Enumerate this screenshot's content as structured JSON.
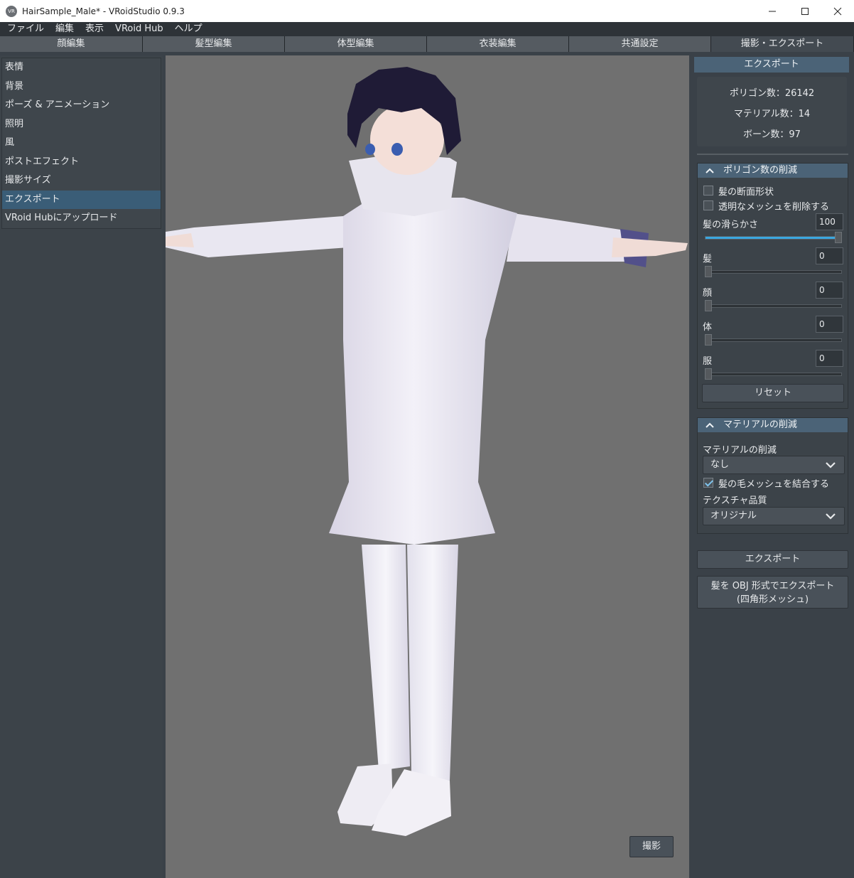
{
  "window": {
    "title": "HairSample_Male* - VRoidStudio 0.9.3",
    "icon_text": "VR"
  },
  "menu": [
    "ファイル",
    "編集",
    "表示",
    "VRoid Hub",
    "ヘルプ"
  ],
  "tabs": [
    "顔編集",
    "髪型編集",
    "体型編集",
    "衣装編集",
    "共通設定",
    "撮影・エクスポート"
  ],
  "left_items": [
    "表情",
    "背景",
    "ポーズ & アニメーション",
    "照明",
    "風",
    "ポストエフェクト",
    "撮影サイズ",
    "エクスポート",
    "VRoid Hubにアップロード"
  ],
  "viewport": {
    "capture_label": "撮影"
  },
  "export_panel": {
    "header": "エクスポート",
    "stats": {
      "polygons": "ポリゴン数：26142",
      "materials": "マテリアル数：14",
      "bones": "ボーン数：97"
    },
    "polygon_section": {
      "title": "ポリゴン数の削減",
      "cb_hair_cross": "髪の断面形状",
      "cb_transparent": "透明なメッシュを削除する",
      "smooth_label": "髪の滑らかさ",
      "smooth_value": "100",
      "smooth_fraction": 1.0,
      "hair_label": "髪",
      "hair_value": "0",
      "face_label": "顔",
      "face_value": "0",
      "body_label": "体",
      "body_value": "0",
      "clothes_label": "服",
      "clothes_value": "0",
      "reset_label": "リセット"
    },
    "material_section": {
      "title": "マテリアルの削減",
      "reduce_label": "マテリアルの削減",
      "reduce_value": "なし",
      "cb_merge_hair": "髪の毛メッシュを結合する",
      "texture_label": "テクスチャ品質",
      "texture_value": "オリジナル"
    },
    "export_button": "エクスポート",
    "obj_export_line1": "髪を OBJ 形式でエクスポート",
    "obj_export_line2": "(四角形メッシュ)"
  }
}
